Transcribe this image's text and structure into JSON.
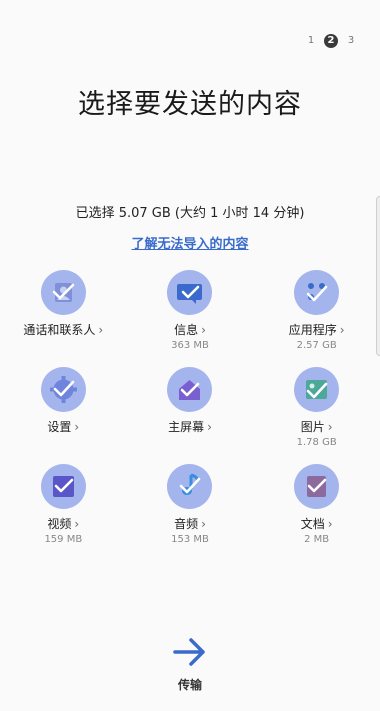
{
  "pager": {
    "pages": [
      "1",
      "2",
      "3"
    ],
    "current": "2"
  },
  "title": "选择要发送的内容",
  "summary": "已选择 5.07 GB  (大约 1 小时 14 分钟)",
  "link": "了解无法导入的内容",
  "items": [
    {
      "label": "通话和联系人",
      "size": "",
      "icon": "contacts-icon"
    },
    {
      "label": "信息",
      "size": "363 MB",
      "icon": "messages-icon"
    },
    {
      "label": "应用程序",
      "size": "2.57 GB",
      "icon": "apps-icon"
    },
    {
      "label": "设置",
      "size": "",
      "icon": "settings-icon"
    },
    {
      "label": "主屏幕",
      "size": "",
      "icon": "home-screen-icon"
    },
    {
      "label": "图片",
      "size": "1.78 GB",
      "icon": "image-icon"
    },
    {
      "label": "视频",
      "size": "159 MB",
      "icon": "video-icon"
    },
    {
      "label": "音频",
      "size": "153 MB",
      "icon": "music-note-icon"
    },
    {
      "label": "文档",
      "size": "2 MB",
      "icon": "document-icon"
    }
  ],
  "send": {
    "label": "传输",
    "icon": "arrow-right-icon"
  },
  "colors": {
    "accent": "#3a6bcc",
    "circle": "#a4b4ec",
    "check": "#ffffff"
  }
}
